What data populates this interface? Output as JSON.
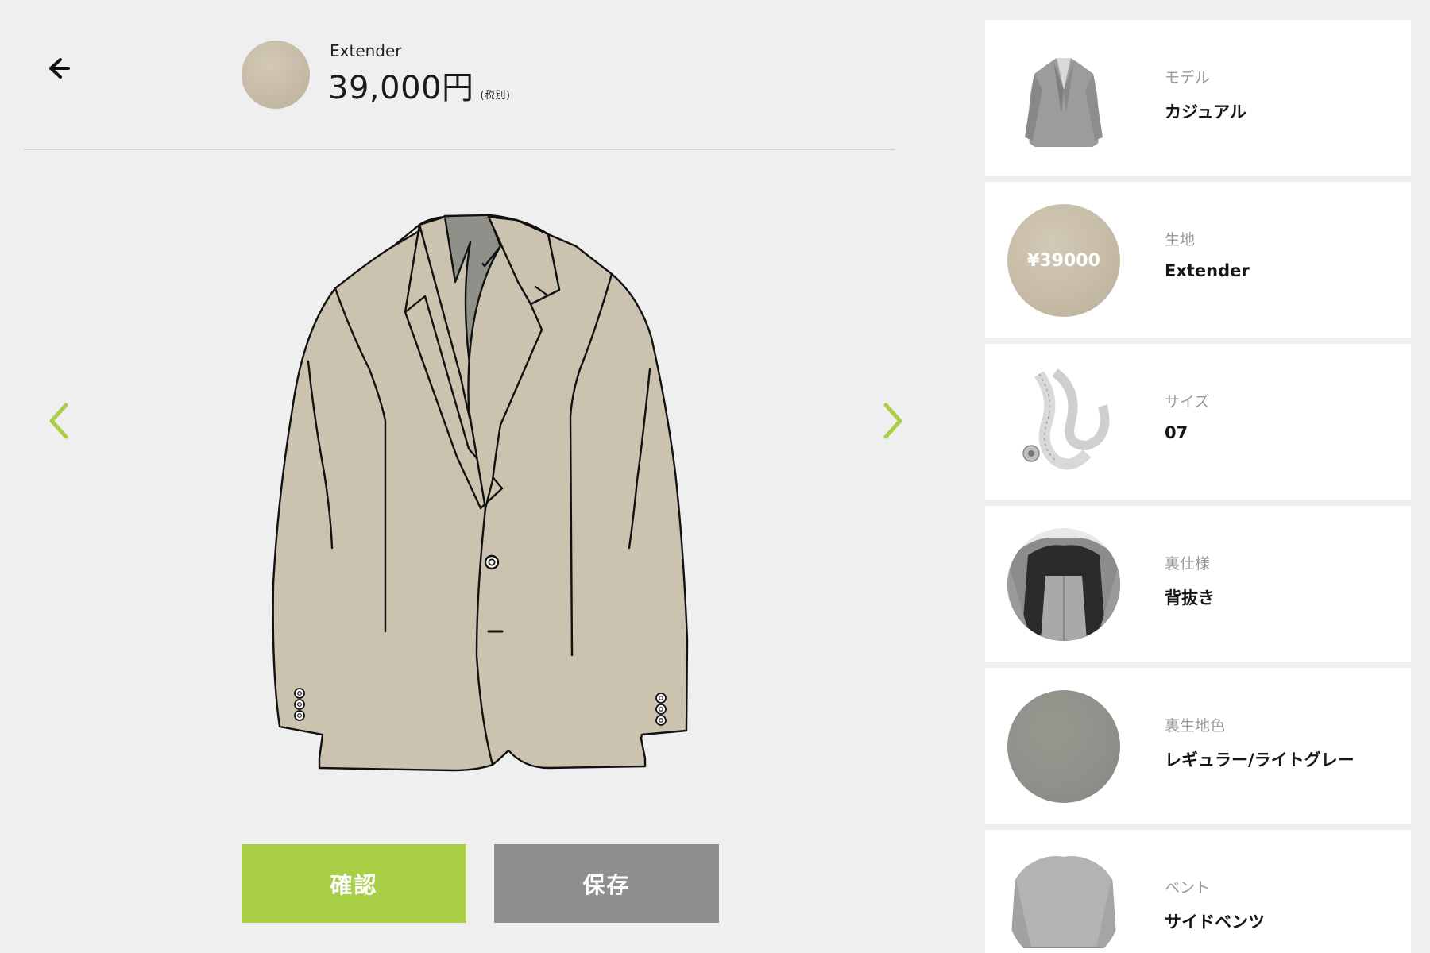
{
  "header": {
    "fabric_name": "Extender",
    "price": "39,000円",
    "tax_note": "(税別)"
  },
  "buttons": {
    "confirm": "確認",
    "save": "保存"
  },
  "colors": {
    "accent_green": "#a8cf45",
    "save_gray": "#8f8f8f",
    "fabric_beige": "#cbc3b0",
    "lining_gray": "#8f908a"
  },
  "options": [
    {
      "label": "モデル",
      "value": "カジュアル",
      "thumb": "casual-jacket-photo"
    },
    {
      "label": "生地",
      "value": "Extender",
      "thumb": "fabric-swatch",
      "thumb_text": "¥39000"
    },
    {
      "label": "サイズ",
      "value": "07",
      "thumb": "measuring-tape-photo"
    },
    {
      "label": "裏仕様",
      "value": "背抜き",
      "thumb": "lining-spec-photo"
    },
    {
      "label": "裏生地色",
      "value": "レギュラー/ライトグレー",
      "thumb": "lining-color-swatch"
    },
    {
      "label": "ベント",
      "value": "サイドベンツ",
      "thumb": "vent-photo"
    }
  ]
}
